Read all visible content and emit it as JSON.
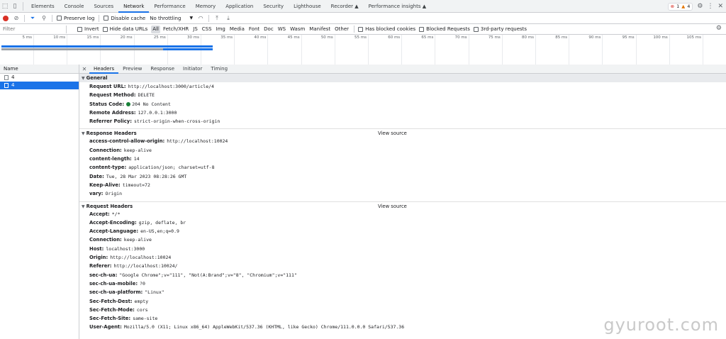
{
  "main_tabs": [
    "Elements",
    "Console",
    "Sources",
    "Network",
    "Performance",
    "Memory",
    "Application",
    "Security",
    "Lighthouse",
    "Recorder ▲",
    "Performance insights ▲"
  ],
  "issues": {
    "errors": "1",
    "warnings": "4"
  },
  "toolbar": {
    "preserve_log": "Preserve log",
    "disable_cache": "Disable cache",
    "throttling": "No throttling"
  },
  "filterbar": {
    "placeholder": "Filter",
    "invert": "Invert",
    "hide_data_urls": "Hide data URLs",
    "types": [
      "All",
      "Fetch/XHR",
      "JS",
      "CSS",
      "Img",
      "Media",
      "Font",
      "Doc",
      "WS",
      "Wasm",
      "Manifest",
      "Other"
    ],
    "has_blocked_cookies": "Has blocked cookies",
    "blocked_requests": "Blocked Requests",
    "third_party": "3rd-party requests"
  },
  "timeline_ticks": [
    "5 ms",
    "10 ms",
    "15 ms",
    "20 ms",
    "25 ms",
    "30 ms",
    "35 ms",
    "40 ms",
    "45 ms",
    "50 ms",
    "55 ms",
    "60 ms",
    "65 ms",
    "70 ms",
    "75 ms",
    "80 ms",
    "85 ms",
    "90 ms",
    "95 ms",
    "100 ms",
    "105 ms"
  ],
  "requests": {
    "column": "Name",
    "items": [
      "4",
      "4"
    ]
  },
  "detail_tabs": [
    "Headers",
    "Preview",
    "Response",
    "Initiator",
    "Timing"
  ],
  "general": {
    "title": "General",
    "rows": [
      {
        "k": "Request URL:",
        "v": "http://localhost:3000/article/4"
      },
      {
        "k": "Request Method:",
        "v": "DELETE"
      },
      {
        "k": "Status Code:",
        "v": "204 No Content"
      },
      {
        "k": "Remote Address:",
        "v": "127.0.0.1:3000"
      },
      {
        "k": "Referrer Policy:",
        "v": "strict-origin-when-cross-origin"
      }
    ]
  },
  "response_headers": {
    "title": "Response Headers",
    "view_source": "View source",
    "rows": [
      {
        "k": "access-control-allow-origin:",
        "v": "http://localhost:10024"
      },
      {
        "k": "Connection:",
        "v": "keep-alive"
      },
      {
        "k": "content-length:",
        "v": "14"
      },
      {
        "k": "content-type:",
        "v": "application/json; charset=utf-8"
      },
      {
        "k": "Date:",
        "v": "Tue, 28 Mar 2023 08:28:26 GMT"
      },
      {
        "k": "Keep-Alive:",
        "v": "timeout=72"
      },
      {
        "k": "vary:",
        "v": "Origin"
      }
    ]
  },
  "request_headers": {
    "title": "Request Headers",
    "view_source": "View source",
    "rows": [
      {
        "k": "Accept:",
        "v": "*/*"
      },
      {
        "k": "Accept-Encoding:",
        "v": "gzip, deflate, br"
      },
      {
        "k": "Accept-Language:",
        "v": "en-US,en;q=0.9"
      },
      {
        "k": "Connection:",
        "v": "keep-alive"
      },
      {
        "k": "Host:",
        "v": "localhost:3000"
      },
      {
        "k": "Origin:",
        "v": "http://localhost:10024"
      },
      {
        "k": "Referer:",
        "v": "http://localhost:10024/"
      },
      {
        "k": "sec-ch-ua:",
        "v": "\"Google Chrome\";v=\"111\", \"Not(A:Brand\";v=\"8\", \"Chromium\";v=\"111\""
      },
      {
        "k": "sec-ch-ua-mobile:",
        "v": "?0"
      },
      {
        "k": "sec-ch-ua-platform:",
        "v": "\"Linux\""
      },
      {
        "k": "Sec-Fetch-Dest:",
        "v": "empty"
      },
      {
        "k": "Sec-Fetch-Mode:",
        "v": "cors"
      },
      {
        "k": "Sec-Fetch-Site:",
        "v": "same-site"
      },
      {
        "k": "User-Agent:",
        "v": "Mozilla/5.0 (X11; Linux x86_64) AppleWebKit/537.36 (KHTML, like Gecko) Chrome/111.0.0.0 Safari/537.36"
      }
    ]
  },
  "watermark": "gyuroot.com"
}
